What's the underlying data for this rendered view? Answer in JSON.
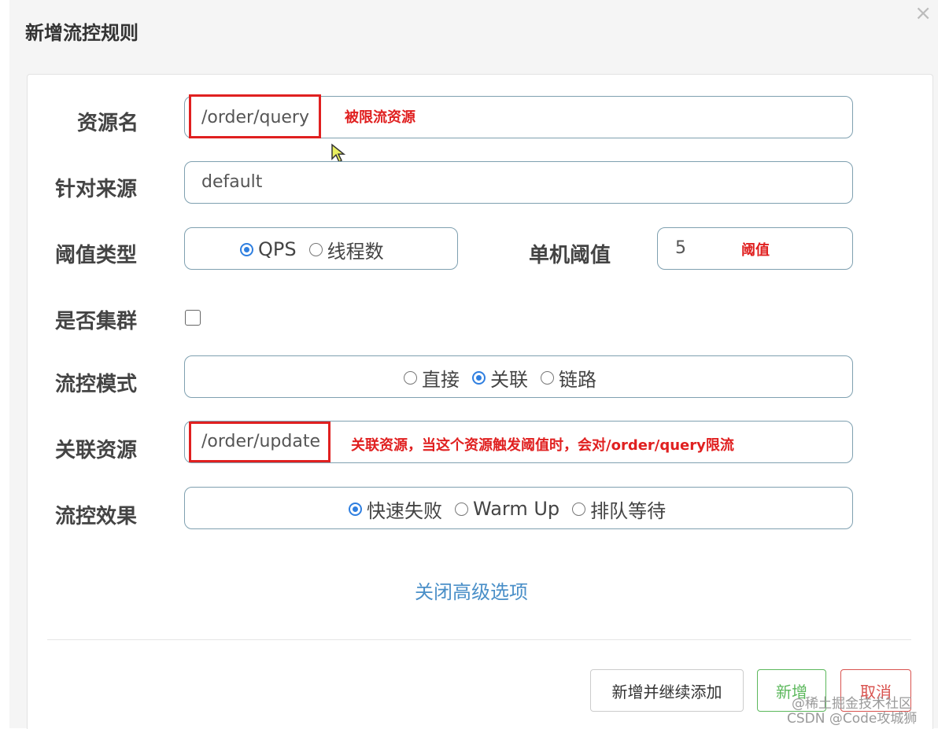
{
  "dialog": {
    "title": "新增流控规则",
    "close_glyph": "×"
  },
  "form": {
    "resource": {
      "label": "资源名",
      "value": "/order/query",
      "annotation": "被限流资源"
    },
    "source": {
      "label": "针对来源",
      "value": "default"
    },
    "threshold_type": {
      "label": "阈值类型",
      "options": [
        "QPS",
        "线程数"
      ],
      "selected": "QPS"
    },
    "single_threshold": {
      "label": "单机阈值",
      "value": "5",
      "annotation": "阈值"
    },
    "cluster": {
      "label": "是否集群",
      "checked": false
    },
    "flow_mode": {
      "label": "流控模式",
      "options": [
        "直接",
        "关联",
        "链路"
      ],
      "selected": "关联"
    },
    "ref_resource": {
      "label": "关联资源",
      "value": "/order/update",
      "annotation": "关联资源，当这个资源触发阈值时，会对/order/query限流"
    },
    "effect": {
      "label": "流控效果",
      "options": [
        "快速失败",
        "Warm Up",
        "排队等待"
      ],
      "selected": "快速失败"
    }
  },
  "advanced_toggle": "关闭高级选项",
  "footer": {
    "add_continue": "新增并继续添加",
    "add": "新增",
    "cancel": "取消"
  },
  "watermark": {
    "line1": "@稀土掘金技术社区",
    "line2": "CSDN @Code攻城狮"
  },
  "colors": {
    "annotation_red": "#e02020",
    "radio_blue": "#2f7fe0",
    "link_blue": "#4a8fc8",
    "add_green": "#5cb85c",
    "cancel_red": "#d9534f"
  }
}
